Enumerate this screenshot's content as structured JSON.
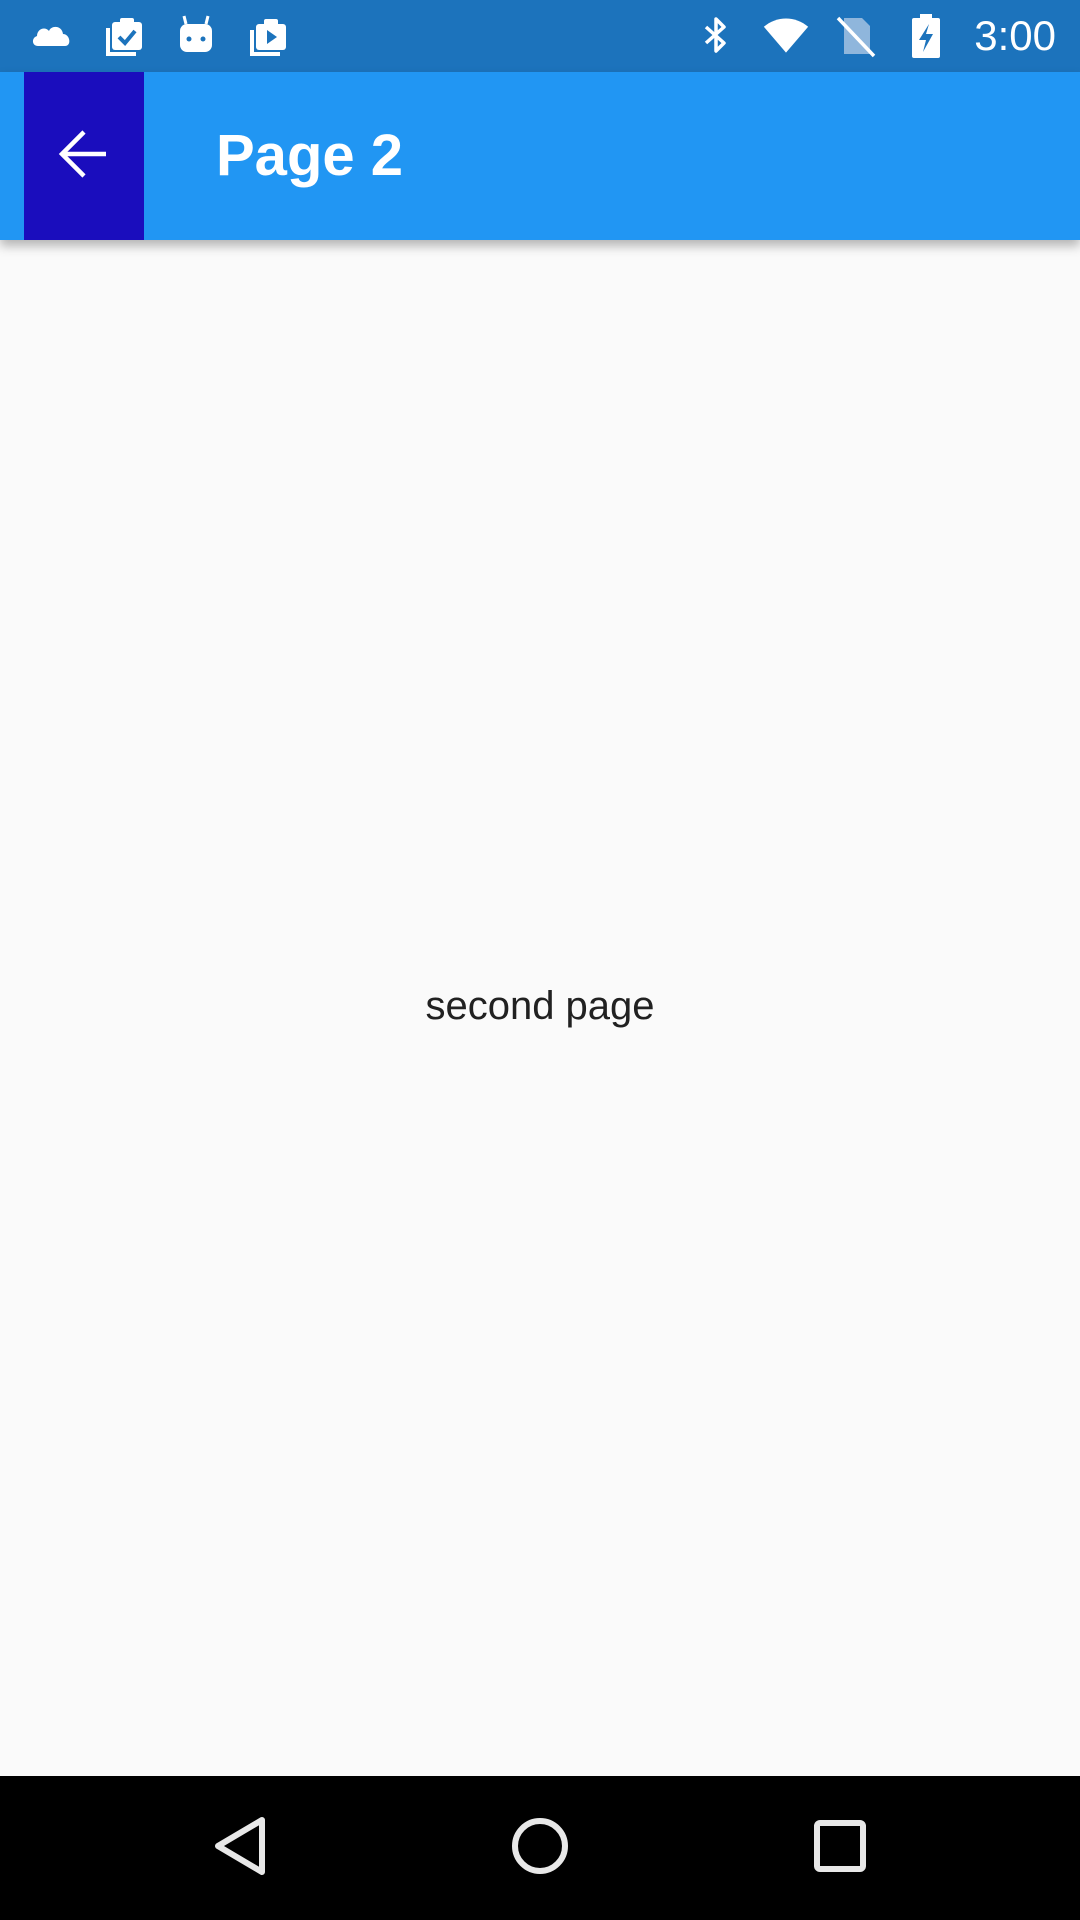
{
  "status_bar": {
    "time": "3:00",
    "left_icons": [
      "cloud-icon",
      "clipboard-check-icon",
      "android-icon",
      "media-queue-icon"
    ],
    "right_icons": [
      "bluetooth-icon",
      "wifi-icon",
      "no-sim-icon",
      "battery-charging-icon"
    ],
    "background_color": "#1c73bc"
  },
  "app_bar": {
    "title": "Page 2",
    "back_icon": "arrow-back-icon",
    "background_color": "#2196f3",
    "back_button_color": "#1a0dbd"
  },
  "content": {
    "text": "second page"
  },
  "nav_bar": {
    "buttons": [
      "back-triangle-icon",
      "home-circle-icon",
      "recents-square-icon"
    ]
  }
}
